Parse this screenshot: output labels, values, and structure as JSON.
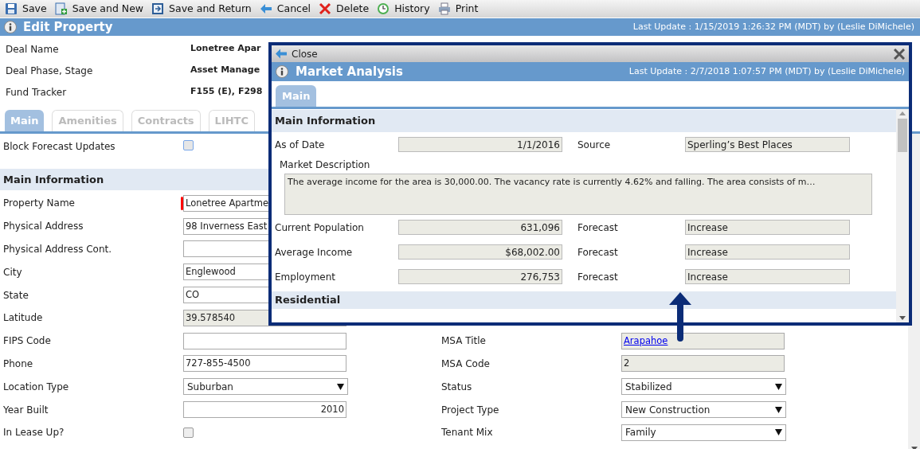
{
  "toolbar": [
    {
      "label": "Save"
    },
    {
      "label": "Save and New"
    },
    {
      "label": "Save and Return"
    },
    {
      "label": "Cancel"
    },
    {
      "label": "Delete"
    },
    {
      "label": "History"
    },
    {
      "label": "Print"
    }
  ],
  "header": {
    "title": "Edit Property",
    "last_update": "Last Update : 1/15/2019 1:26:32 PM (MDT) by (Leslie DiMichele)"
  },
  "deal_info": [
    {
      "label": "Deal Name",
      "value": "Lonetree Apar"
    },
    {
      "label": "Deal Phase, Stage",
      "value": "Asset Manage"
    },
    {
      "label": "Fund Tracker",
      "value": "F155 (E), F298"
    }
  ],
  "tabs": [
    {
      "label": "Main",
      "selected": true
    },
    {
      "label": "Amenities",
      "selected": false
    },
    {
      "label": "Contracts",
      "selected": false
    },
    {
      "label": "LIHTC",
      "selected": false
    }
  ],
  "block_forecast": {
    "label": "Block Forecast Updates",
    "checked": false
  },
  "section": {
    "title": "Main Information"
  },
  "rows": [
    {
      "left": {
        "label": "Property Name",
        "kind": "text",
        "value": "Lonetree Apartme",
        "required": true
      }
    },
    {
      "left": {
        "label": "Physical Address",
        "kind": "text",
        "value": "98 Inverness East",
        "required": false
      }
    },
    {
      "left": {
        "label": "Physical Address Cont.",
        "kind": "text",
        "required": false
      }
    },
    {
      "left": {
        "label": "City",
        "kind": "text",
        "value": "Englewood",
        "required": false
      }
    },
    {
      "left": {
        "label": "State",
        "kind": "text",
        "value": "CO",
        "required": false
      }
    },
    {
      "left": {
        "label": "Latitude",
        "kind": "readonly",
        "value": "39.578540",
        "required": false
      }
    },
    {
      "left": {
        "label": "FIPS Code",
        "kind": "text",
        "required": false
      },
      "right": {
        "label": "MSA Title",
        "kind": "link",
        "value": "Arapahoe"
      }
    },
    {
      "left": {
        "label": "Phone",
        "kind": "text",
        "value": "727-855-4500",
        "required": false
      },
      "right": {
        "label": "MSA Code",
        "kind": "readonly",
        "value": "2"
      }
    },
    {
      "left": {
        "label": "Location Type",
        "kind": "select",
        "value": "Suburban",
        "required": false
      },
      "right": {
        "label": "Status",
        "kind": "select",
        "value": "Stabilized"
      }
    },
    {
      "left": {
        "label": "Year Built",
        "kind": "number",
        "value": "2010",
        "required": false
      },
      "right": {
        "label": "Project Type",
        "kind": "select",
        "value": "New Construction"
      }
    },
    {
      "left": {
        "label": "In Lease Up?",
        "kind": "checkbox",
        "checked": false,
        "required": false
      },
      "right": {
        "label": "Tenant Mix",
        "kind": "select",
        "value": "Family"
      }
    }
  ],
  "popup": {
    "close": "Close",
    "title": "Market Analysis",
    "last_update": "Last Update : 2/7/2018 1:07:57 PM (MDT) by (Leslie DiMichele)",
    "tabs": [
      {
        "label": "Main",
        "selected": true
      }
    ],
    "section": "Main Information",
    "top_row": {
      "label": "As of Date",
      "value": "1/1/2016",
      "side_label": "Source",
      "side_value": "Sperling’s Best Places"
    },
    "description": {
      "label": "Market Description",
      "value": "The average income for the area is 30,000.00. The vacancy rate is currently 4.62% and falling. The area consists of m…"
    },
    "rows": [
      {
        "label": "Current Population",
        "value": "631,096",
        "side_label": "Forecast",
        "side_value": "Increase"
      },
      {
        "label": "Average Income",
        "value": "$68,002.00",
        "side_label": "Forecast",
        "side_value": "Increase"
      },
      {
        "label": "Employment",
        "value": "276,753",
        "side_label": "Forecast",
        "side_value": "Increase"
      }
    ],
    "next_section": "Residential"
  }
}
